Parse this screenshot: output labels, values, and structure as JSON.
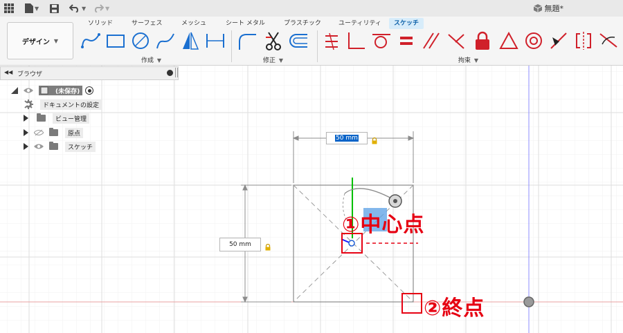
{
  "titlebar": {
    "doc_title": "無題*"
  },
  "toolbar": {
    "workspace": "デザイン",
    "tabs": [
      "ソリッド",
      "サーフェス",
      "メッシュ",
      "シート メタル",
      "プラスチック",
      "ユーティリティ",
      "スケッチ"
    ],
    "active_tab": "スケッチ",
    "groups": [
      "作成",
      "修正",
      "拘束"
    ]
  },
  "browser": {
    "title": "ブラウザ",
    "root": "(未保存)",
    "items": [
      "ドキュメントの設定",
      "ビュー管理",
      "原点",
      "スケッチ"
    ]
  },
  "canvas": {
    "dim_horizontal": "50 mm",
    "dim_vertical": "50 mm",
    "annotation_center": "①中心点",
    "annotation_end": "②終点"
  },
  "colors": {
    "accent": "#0696d7",
    "annotation": "#e60012",
    "axis_red": "#e8a0a0",
    "axis_green": "#00c000",
    "axis_blue": "#8080ff"
  }
}
